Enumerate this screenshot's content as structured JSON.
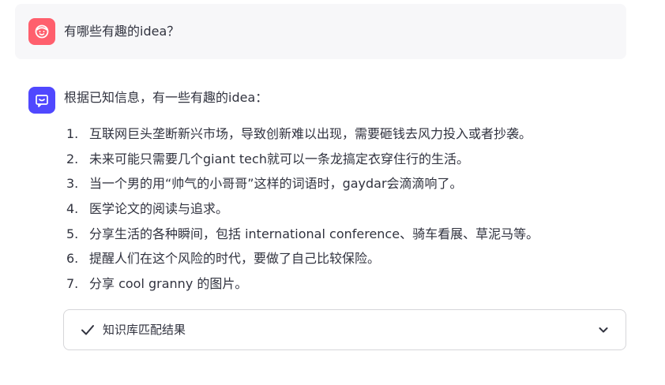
{
  "user_message": {
    "avatar_icon": "smiley-face-icon",
    "avatar_color": "#ff5f6d",
    "text": "有哪些有趣的idea？"
  },
  "assistant_message": {
    "avatar_icon": "chat-bubble-smile-icon",
    "avatar_color": "#5048ff",
    "intro": "根据已知信息，有一些有趣的idea：",
    "ideas": [
      {
        "num": "1.",
        "text": "互联网巨头垄断新兴市场，导致创新难以出现，需要砸钱去风力投入或者抄袭。"
      },
      {
        "num": "2.",
        "text": "未来可能只需要几个giant tech就可以一条龙搞定衣穿住行的生活。"
      },
      {
        "num": "3.",
        "text": "当一个男的用“帅气的小哥哥”这样的词语时，gaydar会滴滴响了。"
      },
      {
        "num": "4.",
        "text": "医学论文的阅读与追求。"
      },
      {
        "num": "5.",
        "text": "分享生活的各种瞬间，包括 international conference、骑车看展、草泥马等。"
      },
      {
        "num": "6.",
        "text": "提醒人们在这个风险的时代，要做了自己比较保险。"
      },
      {
        "num": "7.",
        "text": "分享 cool granny 的图片。"
      }
    ]
  },
  "expander": {
    "label": "知识库匹配结果",
    "status_icon": "checkmark-icon",
    "toggle_icon": "chevron-down-icon",
    "expanded": false
  }
}
